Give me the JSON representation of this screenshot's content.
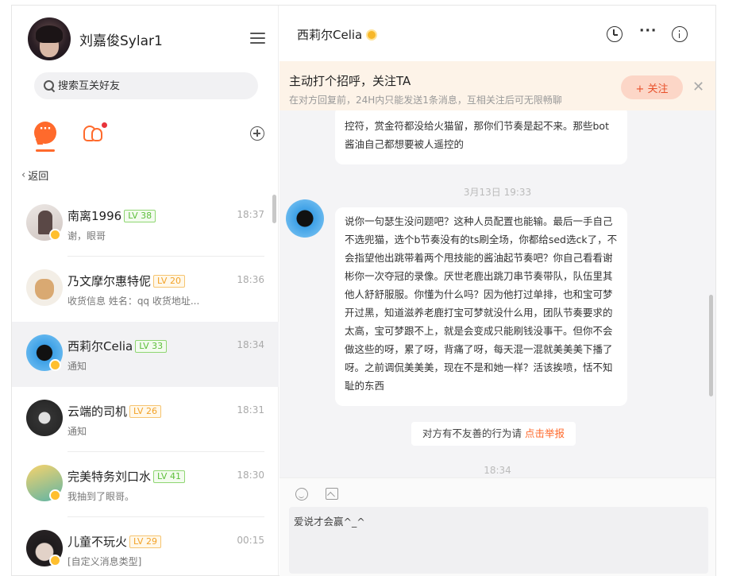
{
  "profile": {
    "username": "刘嘉俊Sylar1"
  },
  "search": {
    "placeholder": "搜索互关好友"
  },
  "nav": {
    "back_label": "返回"
  },
  "contacts": [
    {
      "name": "南离1996",
      "level": "LV 38",
      "level_color": "green",
      "time": "18:37",
      "message": "谢，眼哥"
    },
    {
      "name": "乃文摩尔惠特伲",
      "level": "LV 20",
      "level_color": "orange",
      "time": "18:36",
      "message": "收货信息 姓名：qq 收货地址..."
    },
    {
      "name": "西莉尔Celia",
      "level": "LV 33",
      "level_color": "green",
      "time": "18:34",
      "message": "通知"
    },
    {
      "name": "云端的司机",
      "level": "LV 26",
      "level_color": "orange",
      "time": "18:31",
      "message": "通知"
    },
    {
      "name": "完美特务刘口水",
      "level": "LV 41",
      "level_color": "green",
      "time": "18:30",
      "message": "我抽到了眼哥。"
    },
    {
      "name": "儿童不玩火",
      "level": "LV 29",
      "level_color": "orange",
      "time": "00:15",
      "message": "[自定义消息类型]"
    }
  ],
  "chat": {
    "title": "西莉尔Celia",
    "banner": {
      "title": "主动打个招呼，关注TA",
      "subtitle": "在对方回复前，24H内只能发送1条消息，互相关注后可无限畅聊",
      "follow_label": "+ 关注",
      "close_glyph": "✕"
    },
    "messages": [
      {
        "text": "控符，赏金符都没给火猫留，那你们节奏是起不来。那些bot酱油自己都想要被人遥控的"
      },
      {
        "text": "说你一句瑟生没问题吧？这种人员配置也能输。最后一手自己不选兜猫，选个b节奏没有的ts刷全场，你都给sed选ck了，不会指望他出跳带着两个甩技能的酱油起节奏吧？你自己看看谢彬你一次夺冠的录像。厌世老鹿出跳刀串节奏带队，队伍里其他人舒舒服服。你懂为什么吗？因为他打过单排，也和宝可梦开过黑，知道滋养老鹿打宝可梦就没什么用，团队节奏要求的太高，宝可梦跟不上，就是会变成只能刷钱没事干。但你不会做这些的呀，累了呀，背痛了呀，每天混一混就美美美下播了呀。之前调侃美美美，现在不是和她一样？活该挨喷，恬不知耻的东西"
      }
    ],
    "timestamps": [
      "3月13日 19:33",
      "18:34"
    ],
    "notice": {
      "text": "对方有不友善的行为请 ",
      "link": "点击举报"
    },
    "composer": {
      "placeholder": "爱说才会赢^_^"
    }
  },
  "icons": {
    "menu": "hamburger-menu-icon",
    "search": "search-icon",
    "chat_tab": "chat-bubble-icon",
    "contacts_tab": "contacts-icon",
    "add": "plus-circle-icon",
    "history": "clock-icon",
    "more": "more-dots-icon",
    "info": "info-icon",
    "emoji": "emoji-icon",
    "image": "image-icon"
  },
  "colors": {
    "accent": "#ff6a2c",
    "banner_bg": "#fdf3e8",
    "follow_btn_bg": "#fcd6c7"
  }
}
